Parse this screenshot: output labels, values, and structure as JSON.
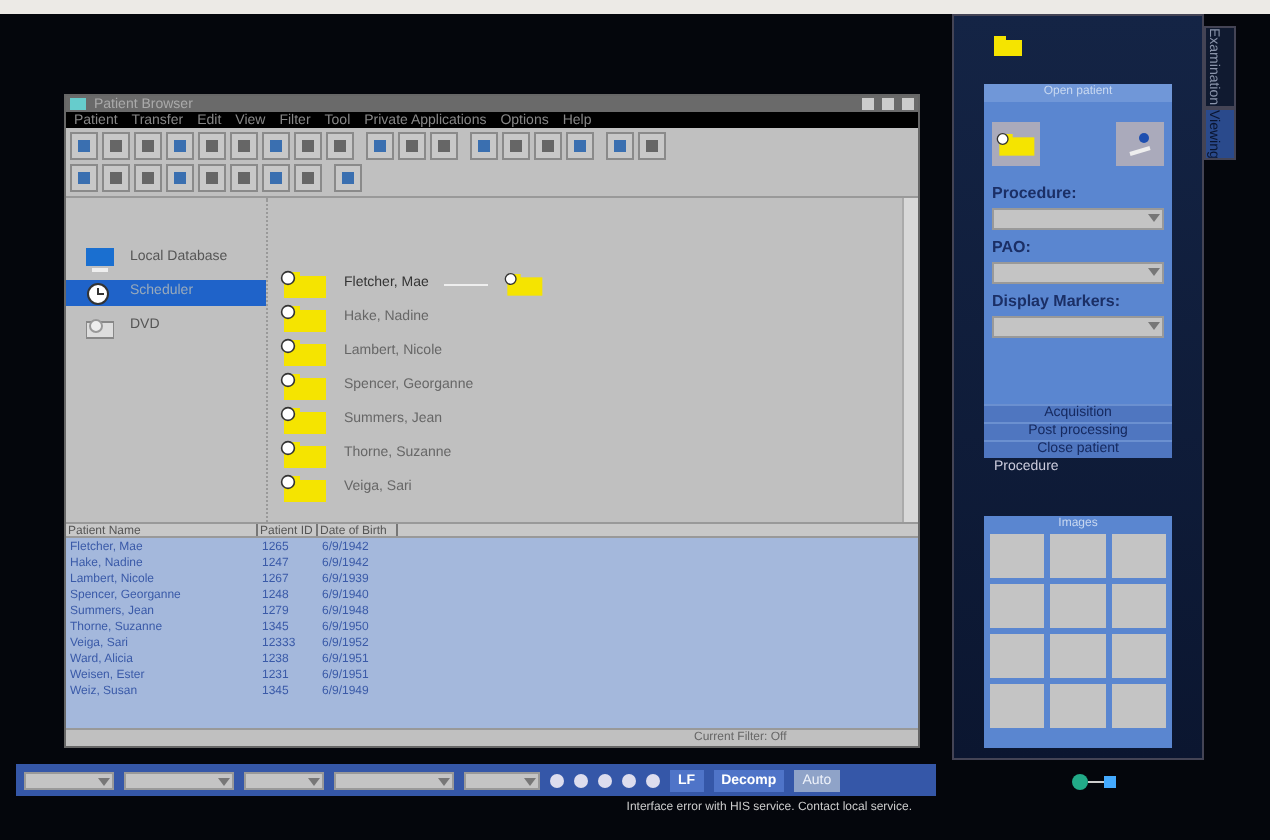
{
  "window": {
    "title": "Patient Browser",
    "menu": [
      "Patient",
      "Transfer",
      "Edit",
      "View",
      "Filter",
      "Tool",
      "Private Applications",
      "Options",
      "Help"
    ]
  },
  "tree": {
    "sources": [
      {
        "label": "Local Database",
        "kind": "database",
        "selected": false
      },
      {
        "label": "Scheduler",
        "kind": "scheduler",
        "selected": true
      },
      {
        "label": "DVD",
        "kind": "dvd",
        "selected": false
      }
    ],
    "patients": [
      {
        "name": "Fletcher, Mae",
        "selected": true
      },
      {
        "name": "Hake, Nadine",
        "selected": false
      },
      {
        "name": "Lambert, Nicole",
        "selected": false
      },
      {
        "name": "Spencer, Georganne",
        "selected": false
      },
      {
        "name": "Summers, Jean",
        "selected": false
      },
      {
        "name": "Thorne, Suzanne",
        "selected": false
      },
      {
        "name": "Veiga, Sari",
        "selected": false
      }
    ]
  },
  "table": {
    "columns": [
      "Patient Name",
      "Patient ID",
      "Date of Birth"
    ],
    "rows": [
      [
        "Fletcher, Mae",
        "1265",
        "6/9/1942"
      ],
      [
        "Hake, Nadine",
        "1247",
        "6/9/1942"
      ],
      [
        "Lambert, Nicole",
        "1267",
        "6/9/1939"
      ],
      [
        "Spencer, Georganne",
        "1248",
        "6/9/1940"
      ],
      [
        "Summers, Jean",
        "1279",
        "6/9/1948"
      ],
      [
        "Thorne, Suzanne",
        "1345",
        "6/9/1950"
      ],
      [
        "Veiga, Sari",
        "12333",
        "6/9/1952"
      ],
      [
        "Ward, Alicia",
        "1238",
        "6/9/1951"
      ],
      [
        "Weisen, Ester",
        "1231",
        "6/9/1951"
      ],
      [
        "Weiz, Susan",
        "1345",
        "6/9/1949"
      ]
    ],
    "status": "Current Filter: Off"
  },
  "side_panel": {
    "tabs": [
      {
        "label": "Examination",
        "selected": false
      },
      {
        "label": "Viewing",
        "selected": true
      }
    ],
    "card_title": "Open patient",
    "fields": [
      "Procedure:",
      "PAO:",
      "Display Markers:"
    ],
    "actions": [
      "Acquisition",
      "Post processing",
      "Close patient"
    ],
    "section_label": "Procedure",
    "images_title": "Images"
  },
  "bottom_bar": {
    "buttons": [
      {
        "label": "LF",
        "disabled": false
      },
      {
        "label": "Decomp",
        "disabled": false
      },
      {
        "label": "Auto",
        "disabled": true
      }
    ],
    "status_message": "Interface error with HIS service. Contact local service."
  }
}
